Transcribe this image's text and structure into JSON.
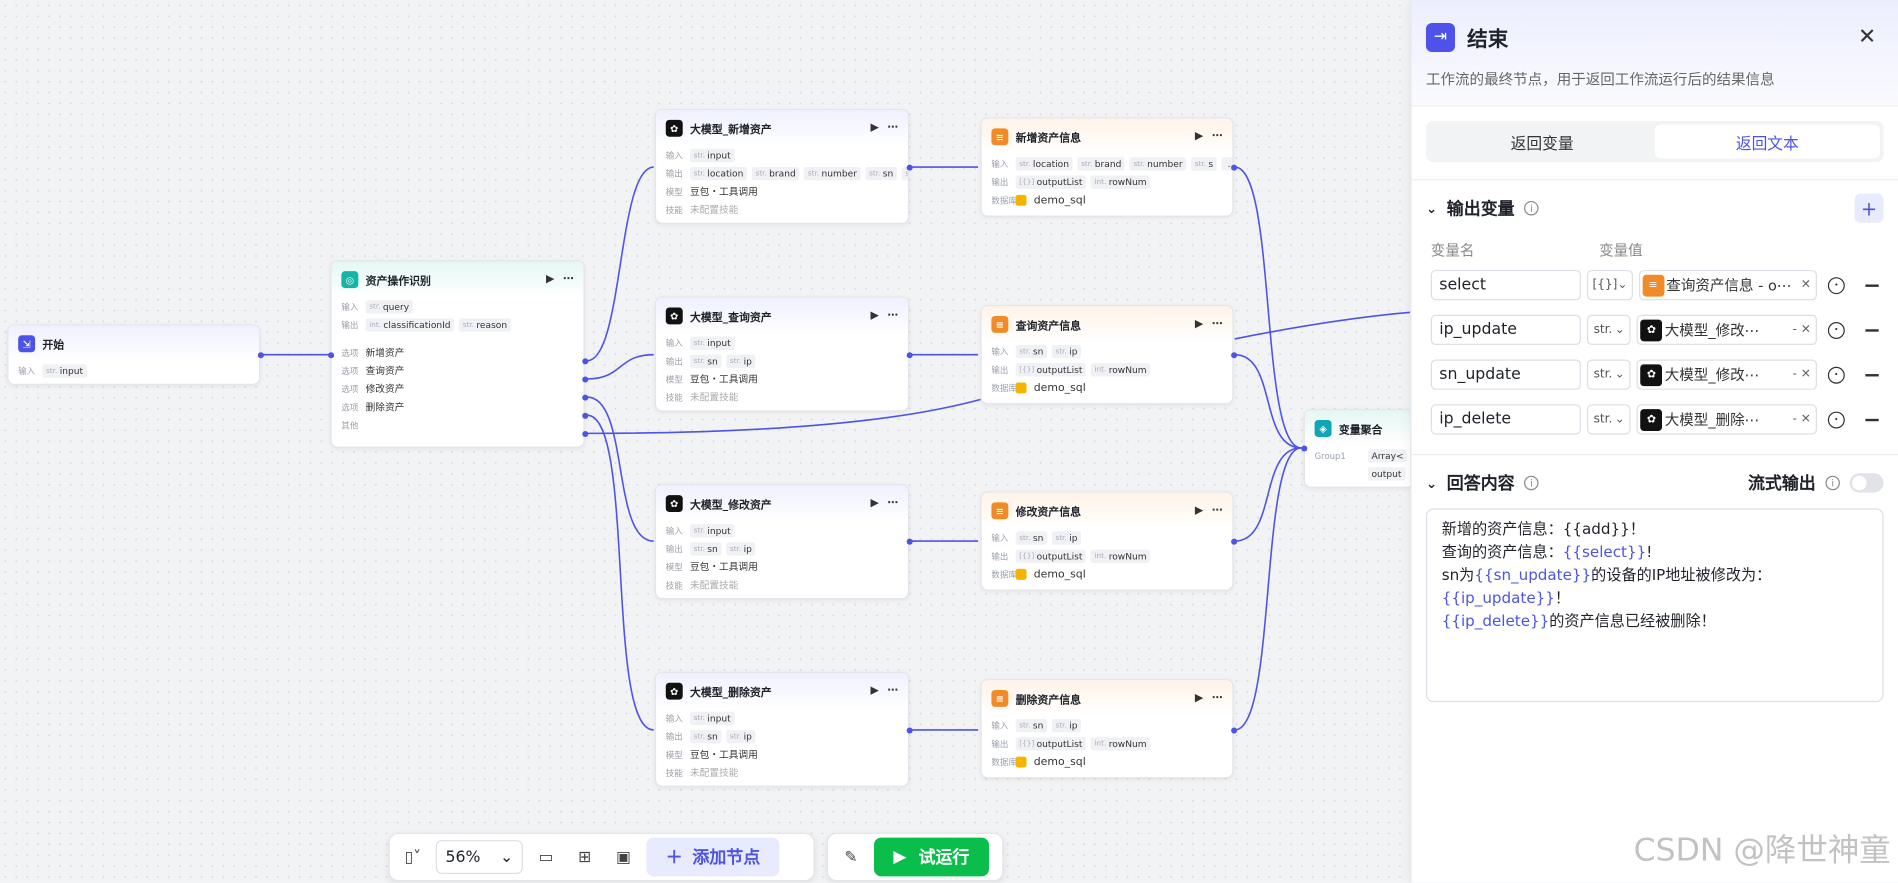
{
  "nodes": {
    "start": {
      "title": "开始",
      "in_label": "输入",
      "inputs": [
        {
          "type": "str.",
          "name": "input"
        }
      ]
    },
    "classify": {
      "title": "资产操作识别",
      "in_label": "输入",
      "out_label": "输出",
      "opt_label": "选项",
      "other_label": "其他",
      "inputs": [
        {
          "type": "str.",
          "name": "query"
        }
      ],
      "outputs": [
        {
          "type": "int.",
          "name": "classificationId"
        },
        {
          "type": "str.",
          "name": "reason"
        }
      ],
      "options": [
        "新增资产",
        "查询资产",
        "修改资产",
        "删除资产"
      ]
    },
    "llm_add": {
      "title": "大模型_新增资产",
      "in_label": "输入",
      "out_label": "输出",
      "model_label": "模型",
      "skill_label": "技能",
      "inputs": [
        {
          "type": "str.",
          "name": "input"
        }
      ],
      "outputs": [
        {
          "type": "str.",
          "name": "location"
        },
        {
          "type": "str.",
          "name": "brand"
        },
        {
          "type": "str.",
          "name": "number"
        },
        {
          "type": "str.",
          "name": "sn"
        },
        {
          "type": "str.",
          "name": "ip"
        }
      ],
      "model": "豆包・工具调用",
      "skill": "未配置技能"
    },
    "llm_query": {
      "title": "大模型_查询资产",
      "in_label": "输入",
      "out_label": "输出",
      "model_label": "模型",
      "skill_label": "技能",
      "inputs": [
        {
          "type": "str.",
          "name": "input"
        }
      ],
      "outputs": [
        {
          "type": "str.",
          "name": "sn"
        },
        {
          "type": "str.",
          "name": "ip"
        }
      ],
      "model": "豆包・工具调用",
      "skill": "未配置技能"
    },
    "llm_update": {
      "title": "大模型_修改资产",
      "in_label": "输入",
      "out_label": "输出",
      "model_label": "模型",
      "skill_label": "技能",
      "inputs": [
        {
          "type": "str.",
          "name": "input"
        }
      ],
      "outputs": [
        {
          "type": "str.",
          "name": "sn"
        },
        {
          "type": "str.",
          "name": "ip"
        }
      ],
      "model": "豆包・工具调用",
      "skill": "未配置技能"
    },
    "llm_delete": {
      "title": "大模型_删除资产",
      "in_label": "输入",
      "out_label": "输出",
      "model_label": "模型",
      "skill_label": "技能",
      "inputs": [
        {
          "type": "str.",
          "name": "input"
        }
      ],
      "outputs": [
        {
          "type": "str.",
          "name": "sn"
        },
        {
          "type": "str.",
          "name": "ip"
        }
      ],
      "model": "豆包・工具调用",
      "skill": "未配置技能"
    },
    "db_add": {
      "title": "新增资产信息",
      "in_label": "输入",
      "out_label": "输出",
      "db_label": "数据库",
      "inputs": [
        {
          "type": "str.",
          "name": "location"
        },
        {
          "type": "str.",
          "name": "brand"
        },
        {
          "type": "str.",
          "name": "number"
        },
        {
          "type": "str.",
          "name": "s"
        },
        {
          "type": "",
          "name": "..."
        }
      ],
      "outputs": [
        {
          "type": "[{}]",
          "name": "outputList"
        },
        {
          "type": "int.",
          "name": "rowNum"
        }
      ],
      "db": "demo_sql"
    },
    "db_query": {
      "title": "查询资产信息",
      "in_label": "输入",
      "out_label": "输出",
      "db_label": "数据库",
      "inputs": [
        {
          "type": "str.",
          "name": "sn"
        },
        {
          "type": "str.",
          "name": "ip"
        }
      ],
      "outputs": [
        {
          "type": "[{}]",
          "name": "outputList"
        },
        {
          "type": "int.",
          "name": "rowNum"
        }
      ],
      "db": "demo_sql"
    },
    "db_update": {
      "title": "修改资产信息",
      "in_label": "输入",
      "out_label": "输出",
      "db_label": "数据库",
      "inputs": [
        {
          "type": "str.",
          "name": "sn"
        },
        {
          "type": "str.",
          "name": "ip"
        }
      ],
      "outputs": [
        {
          "type": "[{}]",
          "name": "outputList"
        },
        {
          "type": "int.",
          "name": "rowNum"
        }
      ],
      "db": "demo_sql"
    },
    "db_delete": {
      "title": "删除资产信息",
      "in_label": "输入",
      "out_label": "输出",
      "db_label": "数据库",
      "inputs": [
        {
          "type": "str.",
          "name": "sn"
        },
        {
          "type": "str.",
          "name": "ip"
        }
      ],
      "outputs": [
        {
          "type": "[{}]",
          "name": "outputList"
        },
        {
          "type": "int.",
          "name": "rowNum"
        }
      ],
      "db": "demo_sql"
    },
    "agg": {
      "title": "变量聚合",
      "group": "Group1",
      "rows": [
        "Array<",
        "output"
      ]
    }
  },
  "toolbar": {
    "zoom": "56%",
    "add_node": "添加节点",
    "run": "试运行"
  },
  "panel": {
    "title": "结束",
    "desc": "工作流的最终节点，用于返回工作流运行后的结果信息",
    "tabs": [
      "返回变量",
      "返回文本"
    ],
    "active_tab": 1,
    "output_section": "输出变量",
    "col_name": "变量名",
    "col_value": "变量值",
    "vars": [
      {
        "name": "select",
        "type": "[{}]",
        "ref": "查询资产信息 - o⋯",
        "ref_icon": "orange"
      },
      {
        "name": "ip_update",
        "type": "str.",
        "ref": "大模型_修改⋯",
        "ref_icon": "black"
      },
      {
        "name": "sn_update",
        "type": "str.",
        "ref": "大模型_修改⋯",
        "ref_icon": "black"
      },
      {
        "name": "ip_delete",
        "type": "str.",
        "ref": "大模型_删除⋯",
        "ref_icon": "black"
      }
    ],
    "answer_section": "回答内容",
    "stream_label": "流式输出",
    "answer": {
      "l1a": "新增的资产信息：{{add}}！",
      "l2a": "查询的资产信息：",
      "l2v": "{{select}}",
      "l2b": "!",
      "l3a": "sn为",
      "l3v": "{{sn_update}}",
      "l3b": "的设备的IP地址被修改为：",
      "l3v2": "{{ip_update}}",
      "l3c": "！",
      "l4v": "{{ip_delete}}",
      "l4b": "的资产信息已经被删除！"
    }
  },
  "watermark": "CSDN @降世神童",
  "colors": {
    "accent": "#4d53e8",
    "run": "#0bbe4b",
    "db": "#f28b27"
  }
}
